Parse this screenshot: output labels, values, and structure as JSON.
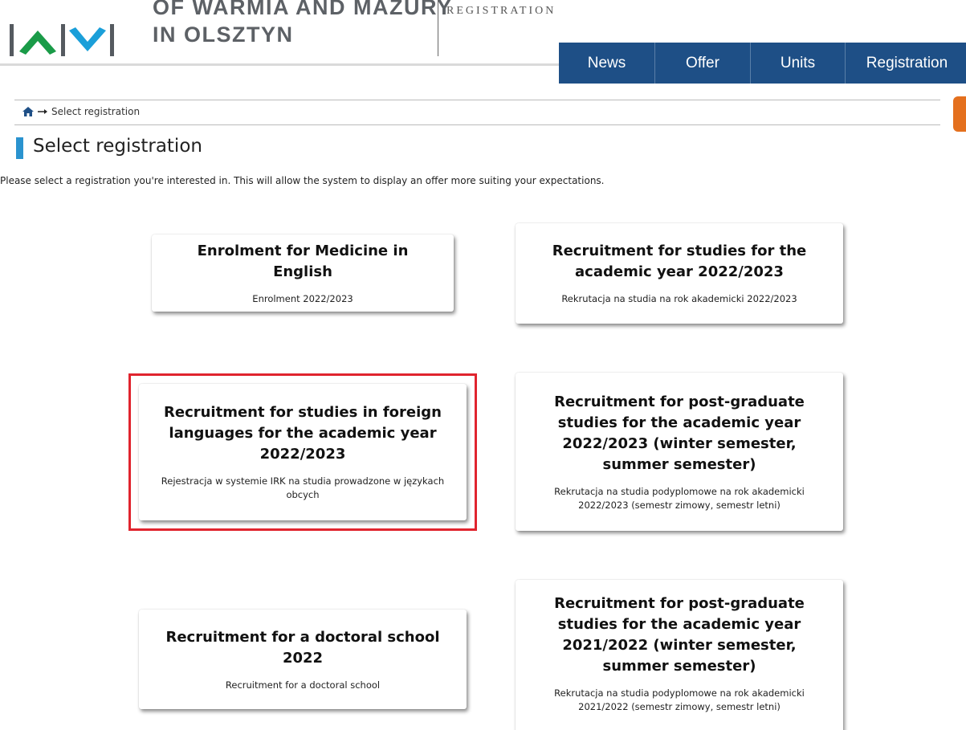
{
  "header": {
    "university_line1": "OF WARMIA AND MAZURY",
    "university_line2": "IN OLSZTYN",
    "system_name": "REGISTRATION",
    "logo_colors": {
      "green": "#1a9b48",
      "blue": "#1b9fd9",
      "bars": "#555a60"
    }
  },
  "nav": {
    "items": [
      {
        "label": "News"
      },
      {
        "label": "Offer"
      },
      {
        "label": "Units"
      },
      {
        "label": "Registration"
      }
    ],
    "color": "#1e4f86"
  },
  "breadcrumb": {
    "home_icon": "home-icon",
    "separator_icon": "arrow-right-icon",
    "current": "Select registration"
  },
  "page": {
    "title": "Select registration",
    "intro": "Please select a registration you're interested in. This will allow the system to display an offer more suiting your expectations.",
    "accent_color": "#2a93cf"
  },
  "cards": [
    {
      "title": "Enrolment for Medicine in English",
      "subtitle": "Enrolment 2022/2023"
    },
    {
      "title": "Recruitment for studies for the academic year 2022/2023",
      "subtitle": "Rekrutacja na studia na rok akademicki 2022/2023"
    },
    {
      "title": "Recruitment for studies in foreign languages for the academic year 2022/2023",
      "subtitle": "Rejestracja w systemie IRK na studia prowadzone w językach obcych"
    },
    {
      "title": "Recruitment for post-graduate studies for the academic year 2022/2023 (winter semester, summer semester)",
      "subtitle": "Rekrutacja na studia podyplomowe na rok akademicki 2022/2023 (semestr zimowy, semestr letni)"
    },
    {
      "title": "Recruitment for a doctoral school 2022",
      "subtitle": "Recruitment for a doctoral school"
    },
    {
      "title": "Recruitment for post-graduate studies for the academic year 2021/2022 (winter semester, summer semester)",
      "subtitle": "Rekrutacja na studia podyplomowe na rok akademicki 2021/2022 (semestr zimowy, semestr letni)"
    }
  ],
  "highlight_color": "#e0242e"
}
